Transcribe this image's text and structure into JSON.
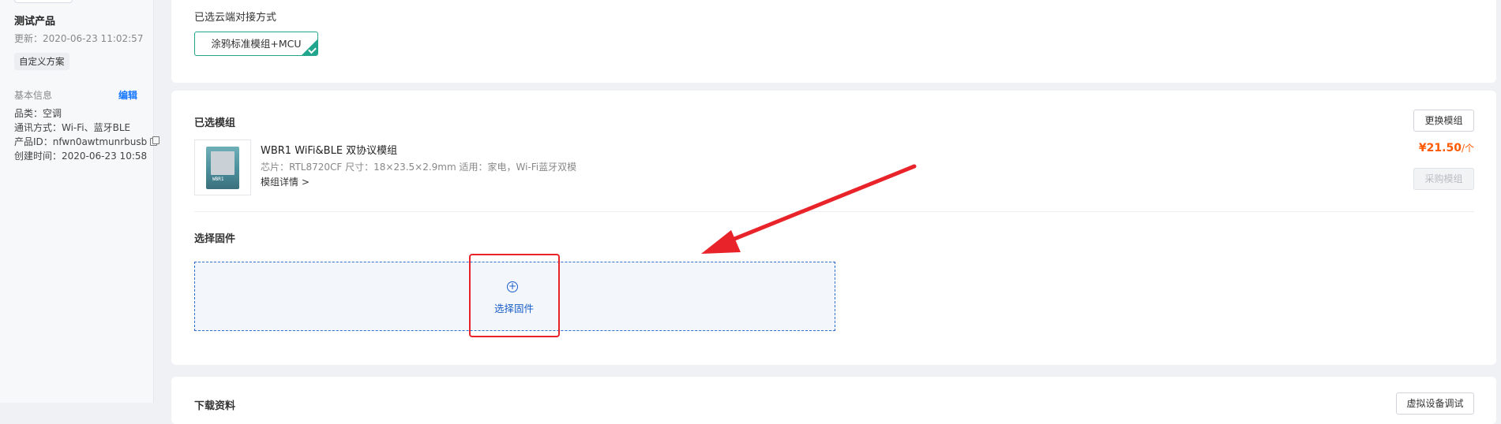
{
  "sidebar": {
    "product_name": "测试产品",
    "updated": "更新：2020-06-23 11:02:57",
    "badge": "自定义方案",
    "section_title": "基本信息",
    "edit_label": "编辑",
    "category": "品类：空调",
    "comm": "通讯方式：Wi-Fi、蓝牙BLE",
    "product_id": "产品ID：nfwn0awtmunrbusb",
    "created": "创建时间：2020-06-23 10:58"
  },
  "cloud": {
    "title": "已选云端对接方式",
    "option": "涂鸦标准模组+MCU"
  },
  "module": {
    "title": "已选模组",
    "change_button": "更换模组",
    "name": "WBR1 WiFi&BLE 双协议模组",
    "spec": "芯片：RTL8720CF   尺寸：18×23.5×2.9mm   适用：家电，Wi-Fi蓝牙双模",
    "detail_link": "模组详情 >",
    "price": "¥21.50",
    "price_unit": "/个",
    "buy_button": "采购模组",
    "chip_mark": "WBR1"
  },
  "firmware": {
    "title": "选择固件",
    "select_label": "选择固件",
    "plus_glyph": "+"
  },
  "download": {
    "title": "下载资料",
    "button": "虚拟设备调试"
  },
  "colors": {
    "accent_teal": "#21a58c",
    "link_blue": "#1a5dc9",
    "price_orange": "#ff5a00",
    "annotation_red": "#e8242a"
  },
  "icons": [
    "copy-icon",
    "checkmark-icon",
    "plus-circle-icon",
    "annotation-arrow"
  ]
}
